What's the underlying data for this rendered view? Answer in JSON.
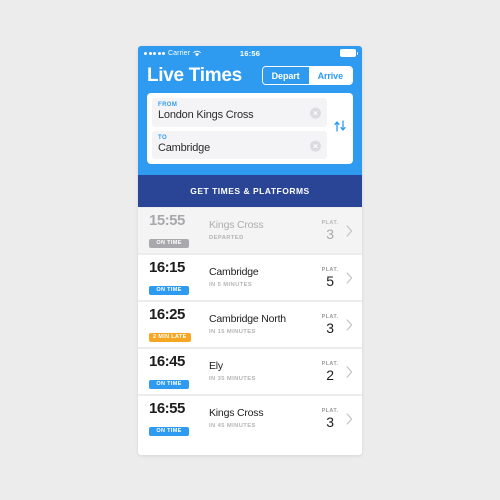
{
  "status_bar": {
    "signal_dots": 5,
    "carrier": "Carrier",
    "wifi_icon": "wifi-icon",
    "time": "16:56",
    "battery_icon": "battery-full-icon"
  },
  "header": {
    "title": "Live Times",
    "segmented": {
      "options": [
        "Depart",
        "Arrive"
      ],
      "selected": "Depart"
    },
    "accent_color": "#2e9bf0"
  },
  "search": {
    "from": {
      "label": "FROM",
      "value": "London Kings Cross",
      "clear_icon": "clear-circle-icon"
    },
    "to": {
      "label": "TO",
      "value": "Cambridge",
      "clear_icon": "clear-circle-icon"
    },
    "swap_icon": "swap-vertical-icon"
  },
  "cta": {
    "label": "GET TIMES & PLATFORMS",
    "color": "#2a4496"
  },
  "departures": {
    "plat_label": "PLAT.",
    "chevron_icon": "chevron-right-icon",
    "rows": [
      {
        "time": "15:55",
        "badge": "ON TIME",
        "badge_style": "grey",
        "destination": "Kings Cross",
        "eta": "DEPARTED",
        "platform": "3",
        "departed": true
      },
      {
        "time": "16:15",
        "badge": "ON TIME",
        "badge_style": "ontime",
        "destination": "Cambridge",
        "eta": "IN 5 MINUTES",
        "platform": "5",
        "departed": false
      },
      {
        "time": "16:25",
        "badge": "2 MIN LATE",
        "badge_style": "late",
        "destination": "Cambridge North",
        "eta": "IN 15 MINUTES",
        "platform": "3",
        "departed": false
      },
      {
        "time": "16:45",
        "badge": "ON TIME",
        "badge_style": "ontime",
        "destination": "Ely",
        "eta": "IN 35 MINUTES",
        "platform": "2",
        "departed": false
      },
      {
        "time": "16:55",
        "badge": "ON TIME",
        "badge_style": "ontime",
        "destination": "Kings Cross",
        "eta": "IN 45 MINUTES",
        "platform": "3",
        "departed": false
      }
    ]
  }
}
